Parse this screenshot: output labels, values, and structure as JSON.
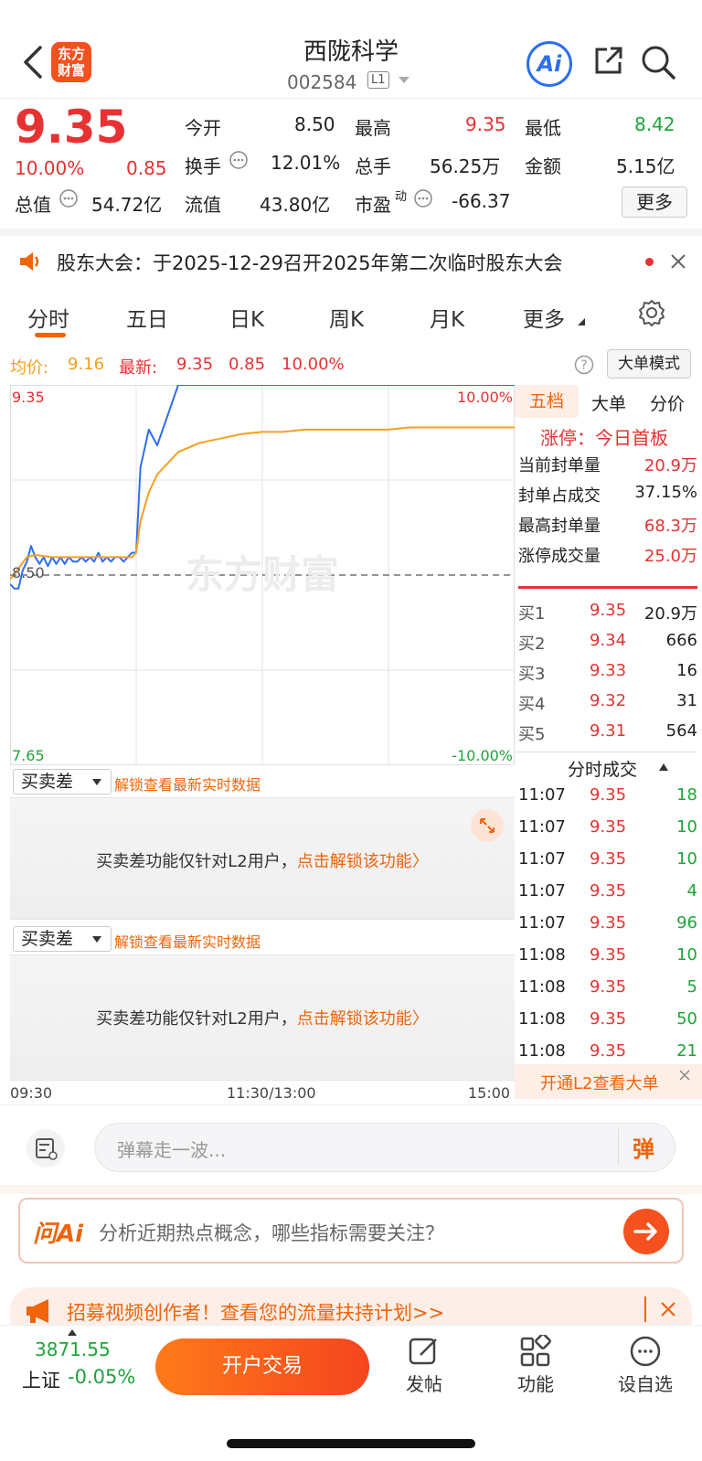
{
  "header": {
    "logo_text": "东方财富",
    "title": "西陇科学",
    "code": "002584",
    "level_badge": "L1",
    "ai_label": "Ai"
  },
  "quote": {
    "price": "9.35",
    "pct_change": "10.00%",
    "change": "0.85",
    "open_label": "今开",
    "open": "8.50",
    "high_label": "最高",
    "high": "9.35",
    "low_label": "最低",
    "low": "8.42",
    "turnover_label": "换手",
    "turnover": "12.01%",
    "volume_label": "总手",
    "volume": "56.25万",
    "amount_label": "金额",
    "amount": "5.15亿",
    "mktcap_label": "总值",
    "mktcap": "54.72亿",
    "float_label": "流值",
    "float": "43.80亿",
    "pe_label": "市盈",
    "pe_sup": "动",
    "pe": "-66.37",
    "more_label": "更多"
  },
  "notice": {
    "text": "股东大会：于2025-12-29召开2025年第二次临时股东大会"
  },
  "tabs": [
    "分时",
    "五日",
    "日K",
    "周K",
    "月K",
    "更多"
  ],
  "chart_info": {
    "avg_label": "均价:",
    "avg": "9.16",
    "latest_label": "最新:",
    "latest": "9.35",
    "chg": "0.85",
    "pct": "10.00%",
    "mode_label": "大单模式"
  },
  "chart_data": {
    "type": "line",
    "title": "",
    "ylim": [
      7.65,
      9.35
    ],
    "y_ticks_left": [
      "9.35",
      "8.50",
      "7.65"
    ],
    "y_ticks_right": [
      "10.00%",
      "-10.00%"
    ],
    "x_ticks": [
      "09:30",
      "11:30/13:00",
      "15:00"
    ],
    "reference": 8.5,
    "watermark": "东方财富",
    "series": [
      {
        "color": "#2b6ff0",
        "x": [
          0,
          2,
          4,
          6,
          8,
          10,
          12,
          14,
          16,
          18,
          20,
          22,
          24,
          26,
          28,
          30,
          32,
          34,
          36,
          38,
          40,
          42,
          44,
          46,
          48,
          50,
          52,
          54,
          56,
          58,
          60,
          62,
          66,
          70,
          80,
          90,
          100,
          110,
          120,
          130,
          140,
          150,
          160,
          170,
          180,
          190,
          200,
          210,
          220,
          230,
          240
        ],
        "y": [
          8.46,
          8.44,
          8.44,
          8.52,
          8.56,
          8.63,
          8.58,
          8.55,
          8.58,
          8.54,
          8.58,
          8.55,
          8.58,
          8.55,
          8.58,
          8.56,
          8.56,
          8.58,
          8.56,
          8.58,
          8.56,
          8.6,
          8.56,
          8.58,
          8.56,
          8.58,
          8.58,
          8.56,
          8.58,
          8.6,
          8.6,
          8.98,
          9.15,
          9.08,
          9.35,
          9.35,
          9.35,
          9.35,
          9.35,
          9.35,
          9.35,
          9.35,
          9.35,
          9.35,
          9.35,
          9.35,
          9.35,
          9.35,
          9.35,
          9.35,
          9.35
        ]
      },
      {
        "color": "#f5a020",
        "x": [
          0,
          4,
          8,
          12,
          20,
          30,
          40,
          50,
          58,
          60,
          62,
          66,
          70,
          80,
          90,
          100,
          110,
          120,
          130,
          140,
          150,
          160,
          170,
          180,
          190,
          200,
          210,
          220,
          230,
          240
        ],
        "y": [
          8.48,
          8.53,
          8.58,
          8.59,
          8.58,
          8.58,
          8.58,
          8.58,
          8.58,
          8.6,
          8.74,
          8.87,
          8.95,
          9.05,
          9.09,
          9.11,
          9.13,
          9.14,
          9.14,
          9.15,
          9.15,
          9.15,
          9.15,
          9.15,
          9.16,
          9.16,
          9.16,
          9.16,
          9.16,
          9.16
        ]
      }
    ]
  },
  "right_panel": {
    "tabs": [
      "五档",
      "大单",
      "分价"
    ],
    "limit_status": "涨停：今日首板",
    "stats": [
      {
        "label": "当前封单量",
        "value": "20.9万"
      },
      {
        "label": "封单占成交",
        "value": "37.15%"
      },
      {
        "label": "最高封单量",
        "value": "68.3万"
      },
      {
        "label": "涨停成交量",
        "value": "25.0万"
      }
    ],
    "bids": [
      {
        "label": "买1",
        "price": "9.35",
        "vol": "20.9万"
      },
      {
        "label": "买2",
        "price": "9.34",
        "vol": "666"
      },
      {
        "label": "买3",
        "price": "9.33",
        "vol": "16"
      },
      {
        "label": "买4",
        "price": "9.32",
        "vol": "31"
      },
      {
        "label": "买5",
        "price": "9.31",
        "vol": "564"
      }
    ],
    "ticks_title": "分时成交",
    "ticks": [
      {
        "time": "11:07",
        "price": "9.35",
        "vol": "18"
      },
      {
        "time": "11:07",
        "price": "9.35",
        "vol": "10"
      },
      {
        "time": "11:07",
        "price": "9.35",
        "vol": "10"
      },
      {
        "time": "11:07",
        "price": "9.35",
        "vol": "4"
      },
      {
        "time": "11:07",
        "price": "9.35",
        "vol": "96"
      },
      {
        "time": "11:08",
        "price": "9.35",
        "vol": "10"
      },
      {
        "time": "11:08",
        "price": "9.35",
        "vol": "5"
      },
      {
        "time": "11:08",
        "price": "9.35",
        "vol": "50"
      },
      {
        "time": "11:08",
        "price": "9.35",
        "vol": "21"
      }
    ],
    "l2_banner": "开通L2查看大单"
  },
  "l2": {
    "select_label": "买卖差",
    "unlock_hint": "解锁查看最新实时数据",
    "msg": "买卖差功能仅针对L2用户，",
    "msg_link": "点击解锁该功能〉"
  },
  "danmu": {
    "placeholder": "弹幕走一波...",
    "btn": "弹"
  },
  "ask_ai": {
    "brand": "问Ai",
    "prompt": "分析近期热点概念，哪些指标需要关注？"
  },
  "recruit": {
    "text": "招募视频创作者！查看您的流量扶持计划>>"
  },
  "bottom": {
    "index_value": "3871.55",
    "index_name": "上证",
    "index_change": "-0.05%",
    "open_account": "开户交易",
    "post": "发帖",
    "functions": "功能",
    "watchlist": "设自选"
  }
}
